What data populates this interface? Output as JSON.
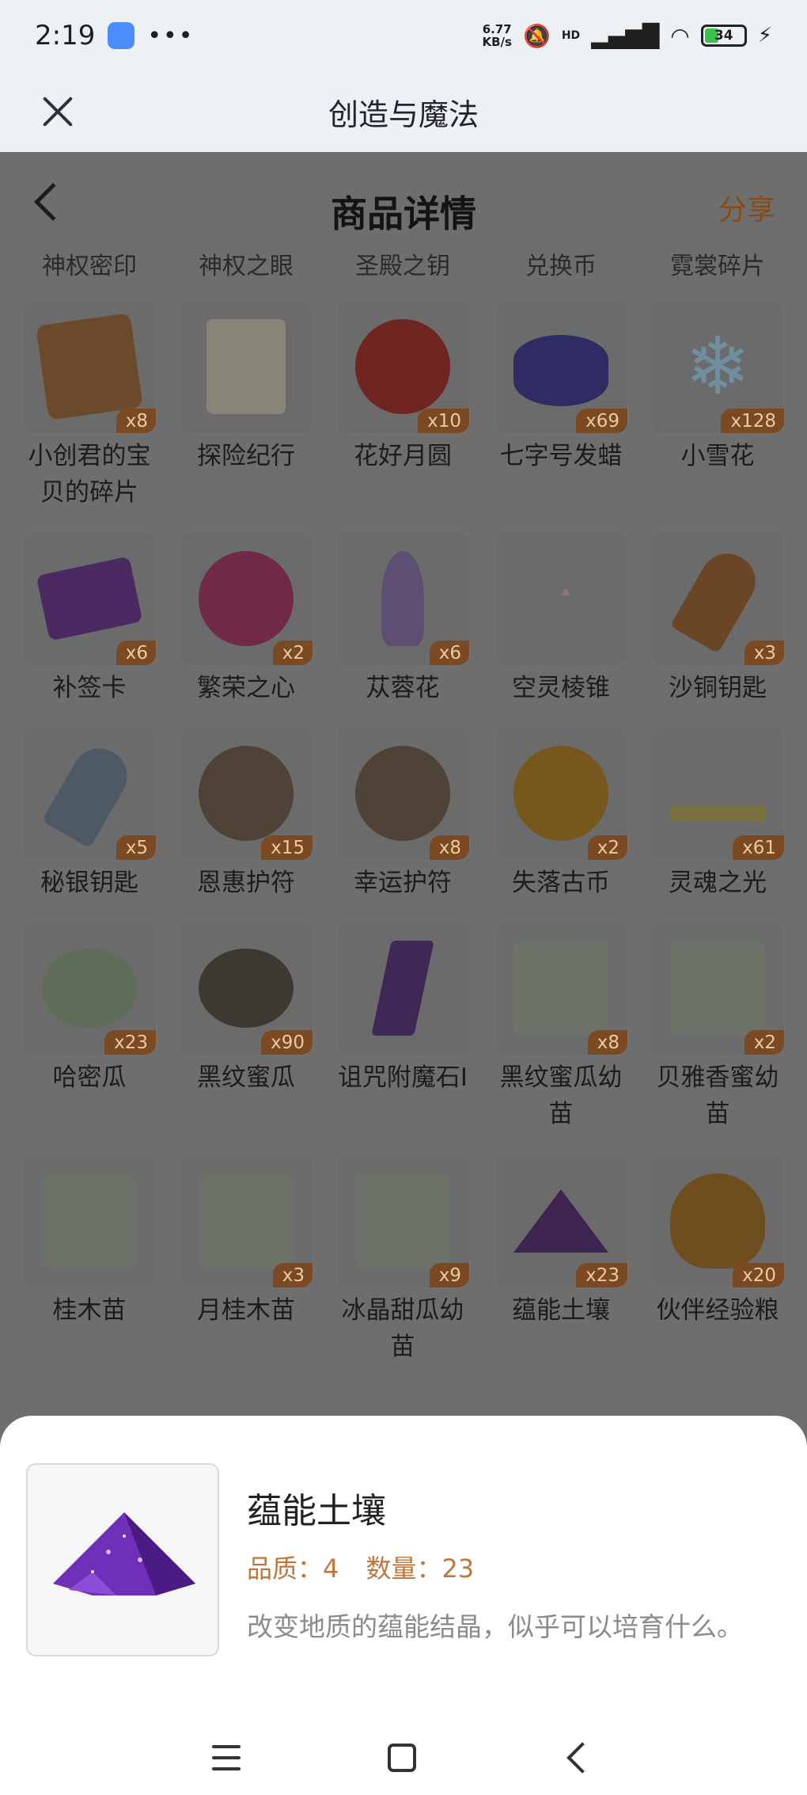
{
  "status_bar": {
    "time": "2:19",
    "net_speed_value": "6.77",
    "net_speed_unit": "KB/s",
    "network": "HD",
    "battery": "34"
  },
  "title_bar": {
    "title": "创造与魔法"
  },
  "page": {
    "title": "商品详情",
    "share_label": "分享",
    "categories": [
      "神权密印",
      "神权之眼",
      "圣殿之钥",
      "兑换币",
      "霓裳碎片"
    ]
  },
  "items": [
    {
      "name": "小创君的宝贝的碎片",
      "count": "x8",
      "icon": "puzzle-icon"
    },
    {
      "name": "探险纪行",
      "count": "",
      "icon": "scroll-icon"
    },
    {
      "name": "花好月圆",
      "count": "x10",
      "icon": "moon-icon"
    },
    {
      "name": "七字号发蜡",
      "count": "x69",
      "icon": "hair-wax-icon"
    },
    {
      "name": "小雪花",
      "count": "x128",
      "icon": "snowflake-icon"
    },
    {
      "name": "补签卡",
      "count": "x6",
      "icon": "ticket-icon"
    },
    {
      "name": "繁荣之心",
      "count": "x2",
      "icon": "heart-gem-icon"
    },
    {
      "name": "苁蓉花",
      "count": "x6",
      "icon": "flower-icon"
    },
    {
      "name": "空灵棱锥",
      "count": "",
      "icon": "pyramid-icon"
    },
    {
      "name": "沙铜钥匙",
      "count": "x3",
      "icon": "bronze-key-icon"
    },
    {
      "name": "秘银钥匙",
      "count": "x5",
      "icon": "silver-key-icon"
    },
    {
      "name": "恩惠护符",
      "count": "x15",
      "icon": "amulet-icon"
    },
    {
      "name": "幸运护符",
      "count": "x8",
      "icon": "lucky-amulet-icon"
    },
    {
      "name": "失落古币",
      "count": "x2",
      "icon": "coin-icon"
    },
    {
      "name": "灵魂之光",
      "count": "x61",
      "icon": "crown-icon"
    },
    {
      "name": "哈密瓜",
      "count": "x23",
      "icon": "melon-icon"
    },
    {
      "name": "黑纹蜜瓜",
      "count": "x90",
      "icon": "striped-melon-icon"
    },
    {
      "name": "诅咒附魔石Ⅰ",
      "count": "",
      "icon": "crystal-icon"
    },
    {
      "name": "黑纹蜜瓜幼苗",
      "count": "x8",
      "icon": "seed-bag-icon"
    },
    {
      "name": "贝雅香蜜幼苗",
      "count": "x2",
      "icon": "seed-bag-icon"
    },
    {
      "name": "桂木苗",
      "count": "",
      "icon": "seed-bag-icon"
    },
    {
      "name": "月桂木苗",
      "count": "x3",
      "icon": "seed-bag-icon"
    },
    {
      "name": "冰晶甜瓜幼苗",
      "count": "x9",
      "icon": "seed-bag-icon"
    },
    {
      "name": "蕴能土壤",
      "count": "x23",
      "icon": "soil-icon"
    },
    {
      "name": "伙伴经验粮",
      "count": "x20",
      "icon": "food-bag-icon"
    }
  ],
  "detail_sheet": {
    "name": "蕴能土壤",
    "quality": "品质：4",
    "quantity": "数量：23",
    "description": "改变地质的蕴能结晶，似乎可以培育什么。",
    "icon": "soil-icon"
  },
  "nav_bar": {
    "buttons": [
      "menu-icon",
      "home-icon",
      "back-icon"
    ]
  },
  "colors": {
    "accent": "#c0763a",
    "count_badge": "#7b4a22",
    "overlay": "#6e6e6e"
  }
}
